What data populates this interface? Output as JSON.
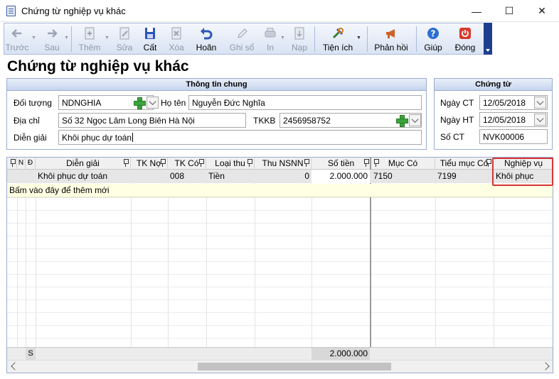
{
  "window": {
    "title": "Chứng từ nghiệp vụ khác",
    "app_icon": "document-icon",
    "controls": {
      "minimize": "—",
      "maximize": "☐",
      "close": "✕"
    }
  },
  "toolbar": {
    "buttons": [
      {
        "label": "Trước",
        "icon": "arrow-left-icon",
        "enabled": false
      },
      {
        "label": "Sau",
        "icon": "arrow-right-icon",
        "enabled": false
      },
      {
        "label": "Thêm",
        "icon": "add-document-icon",
        "enabled": false
      },
      {
        "label": "Sửa",
        "icon": "edit-icon",
        "enabled": false
      },
      {
        "label": "Cất",
        "icon": "save-icon",
        "enabled": true
      },
      {
        "label": "Xóa",
        "icon": "delete-icon",
        "enabled": false
      },
      {
        "label": "Hoãn",
        "icon": "undo-icon",
        "enabled": true
      },
      {
        "label": "Ghi sổ",
        "icon": "pencil-icon",
        "enabled": false
      },
      {
        "label": "In",
        "icon": "print-icon",
        "enabled": false
      },
      {
        "label": "Nạp",
        "icon": "load-icon",
        "enabled": false
      },
      {
        "label": "Tiện ích",
        "icon": "tools-icon",
        "enabled": true
      },
      {
        "label": "Phản hồi",
        "icon": "megaphone-icon",
        "enabled": true
      },
      {
        "label": "Giúp",
        "icon": "help-icon",
        "enabled": true
      },
      {
        "label": "Đóng",
        "icon": "power-icon",
        "enabled": true
      }
    ]
  },
  "heading": "Chứng từ nghiệp vụ khác",
  "general_info": {
    "title": "Thông tin chung",
    "doi_tuong_label": "Đối tượng",
    "doi_tuong_value": "NDNGHIA",
    "ho_ten_label": "Họ tên",
    "ho_ten_value": "Nguyễn Đức Nghĩa",
    "dia_chi_label": "Địa chỉ",
    "dia_chi_value": "Số 32 Ngọc Lâm Long Biên Hà Nội",
    "tkkb_label": "TKKB",
    "tkkb_value": "2456958752",
    "dien_giai_label": "Diễn giải",
    "dien_giai_value": "Khôi phục dự toán"
  },
  "voucher": {
    "title": "Chứng từ",
    "ngay_ct_label": "Ngày CT",
    "ngay_ct_value": "12/05/2018",
    "ngay_ht_label": "Ngày HT",
    "ngay_ht_value": "12/05/2018",
    "so_ct_label": "Số CT",
    "so_ct_value": "NVK00006"
  },
  "grid": {
    "columns": [
      "N",
      "Đ",
      "Diễn giải",
      "TK Nợ",
      "TK Có",
      "Loại thu",
      "Thu NSNN",
      "Số tiền",
      "Mục Có",
      "Tiểu mục Có",
      "Nghiệp vụ"
    ],
    "rows": [
      {
        "dien_giai": "Khôi phục dự toán",
        "tk_no": "",
        "tk_co": "008",
        "loai_thu": "Tiền",
        "thu_nsnn": "0",
        "so_tien": "2.000.000",
        "muc_co": "7150",
        "tieu_muc_co": "7199",
        "nghiep_vu": "Khôi phục"
      }
    ],
    "add_row_text": "Bấm vào đây để thêm mới",
    "footer_marker": "S",
    "footer_total": "2.000.000"
  },
  "colors": {
    "accent": "#1e3f8f",
    "highlight": "#d9343a",
    "new_row": "#ffffe3"
  }
}
